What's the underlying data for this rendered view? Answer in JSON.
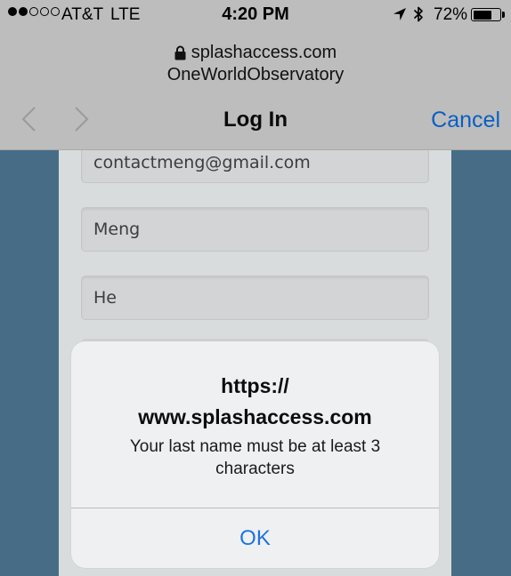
{
  "status_bar": {
    "carrier": "AT&T",
    "network": "LTE",
    "time": "4:20 PM",
    "battery_percent": "72%",
    "battery_level": 0.72,
    "signal_bars_filled": 2,
    "signal_bars_total": 5
  },
  "browser": {
    "url": "splashaccess.com",
    "site_name": "OneWorldObservatory",
    "title": "Log In",
    "cancel_label": "Cancel",
    "accent_color": "#0a5fc4"
  },
  "form": {
    "email_value": "contactmeng@gmail.com",
    "first_name_value": "Meng",
    "last_name_value": "He"
  },
  "alert": {
    "title_line1": "https://",
    "title_line2": "www.splashaccess.com",
    "message_line1": "Your last name must be at least 3",
    "message_line2": "characters",
    "ok_label": "OK"
  }
}
